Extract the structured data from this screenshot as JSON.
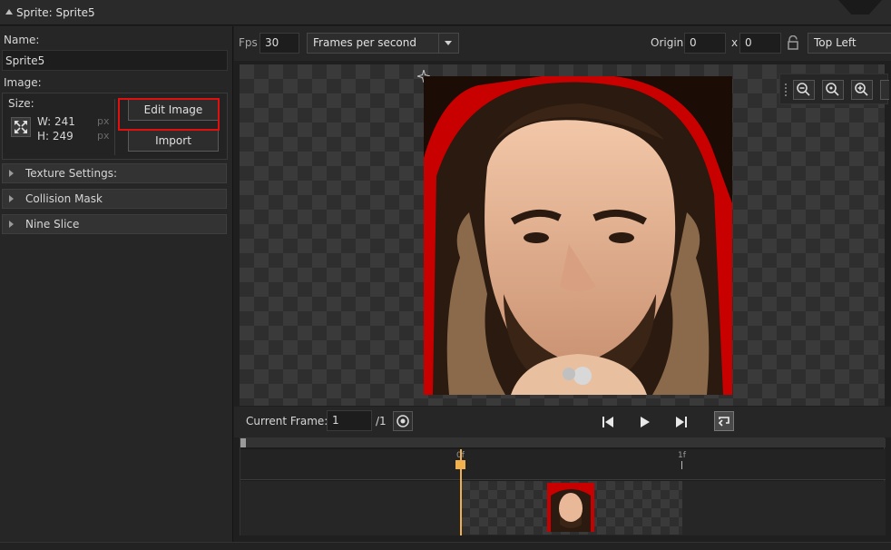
{
  "titlebar": {
    "title": "Sprite: Sprite5"
  },
  "properties": {
    "name_label": "Name:",
    "name_value": "Sprite5",
    "image_label": "Image:",
    "size_label": "Size:",
    "width_text": "W: 241",
    "height_text": "H: 249",
    "unit": "px",
    "edit_image_button": "Edit Image",
    "import_button": "Import",
    "sections": [
      "Texture Settings:",
      "Collision Mask",
      "Nine Slice"
    ]
  },
  "toolbar": {
    "fps_label": "Fps",
    "fps_value": "30",
    "fps_mode": "Frames per second",
    "origin_label": "Origin",
    "origin_x": "0",
    "origin_sep": "x",
    "origin_y": "0",
    "origin_preset": "Top Left"
  },
  "playback": {
    "current_frame_label": "Current Frame:",
    "current_frame_value": "1",
    "frame_total": "/1"
  },
  "timeline": {
    "ticks": [
      "0f",
      "1f"
    ]
  },
  "colors": {
    "accent_highlight": "#e01010",
    "playhead": "#f0b050"
  }
}
